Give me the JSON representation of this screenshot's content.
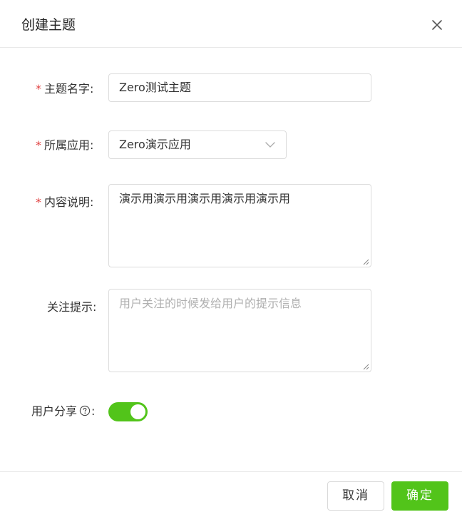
{
  "dialog": {
    "title": "创建主题",
    "close_icon": "close-icon"
  },
  "form": {
    "required_mark": "*",
    "topic_name": {
      "label": "主题名字:",
      "value": "Zero测试主题",
      "required": true
    },
    "app": {
      "label": "所属应用:",
      "value": "Zero演示应用",
      "required": true,
      "icon": "chevron-down-icon"
    },
    "description": {
      "label": "内容说明:",
      "value": "演示用演示用演示用演示用演示用",
      "required": true
    },
    "follow_tip": {
      "label": "关注提示:",
      "value": "",
      "placeholder": "用户关注的时候发给用户的提示信息",
      "required": false
    },
    "user_share": {
      "label": "用户分享",
      "colon": ":",
      "help_icon": "question-circle-icon",
      "enabled": true
    }
  },
  "footer": {
    "cancel_label": "取消",
    "confirm_label": "确定"
  },
  "colors": {
    "accent": "#52c41a",
    "required": "#e04040",
    "placeholder": "#b0b0b0",
    "border": "#dcdcdc"
  }
}
